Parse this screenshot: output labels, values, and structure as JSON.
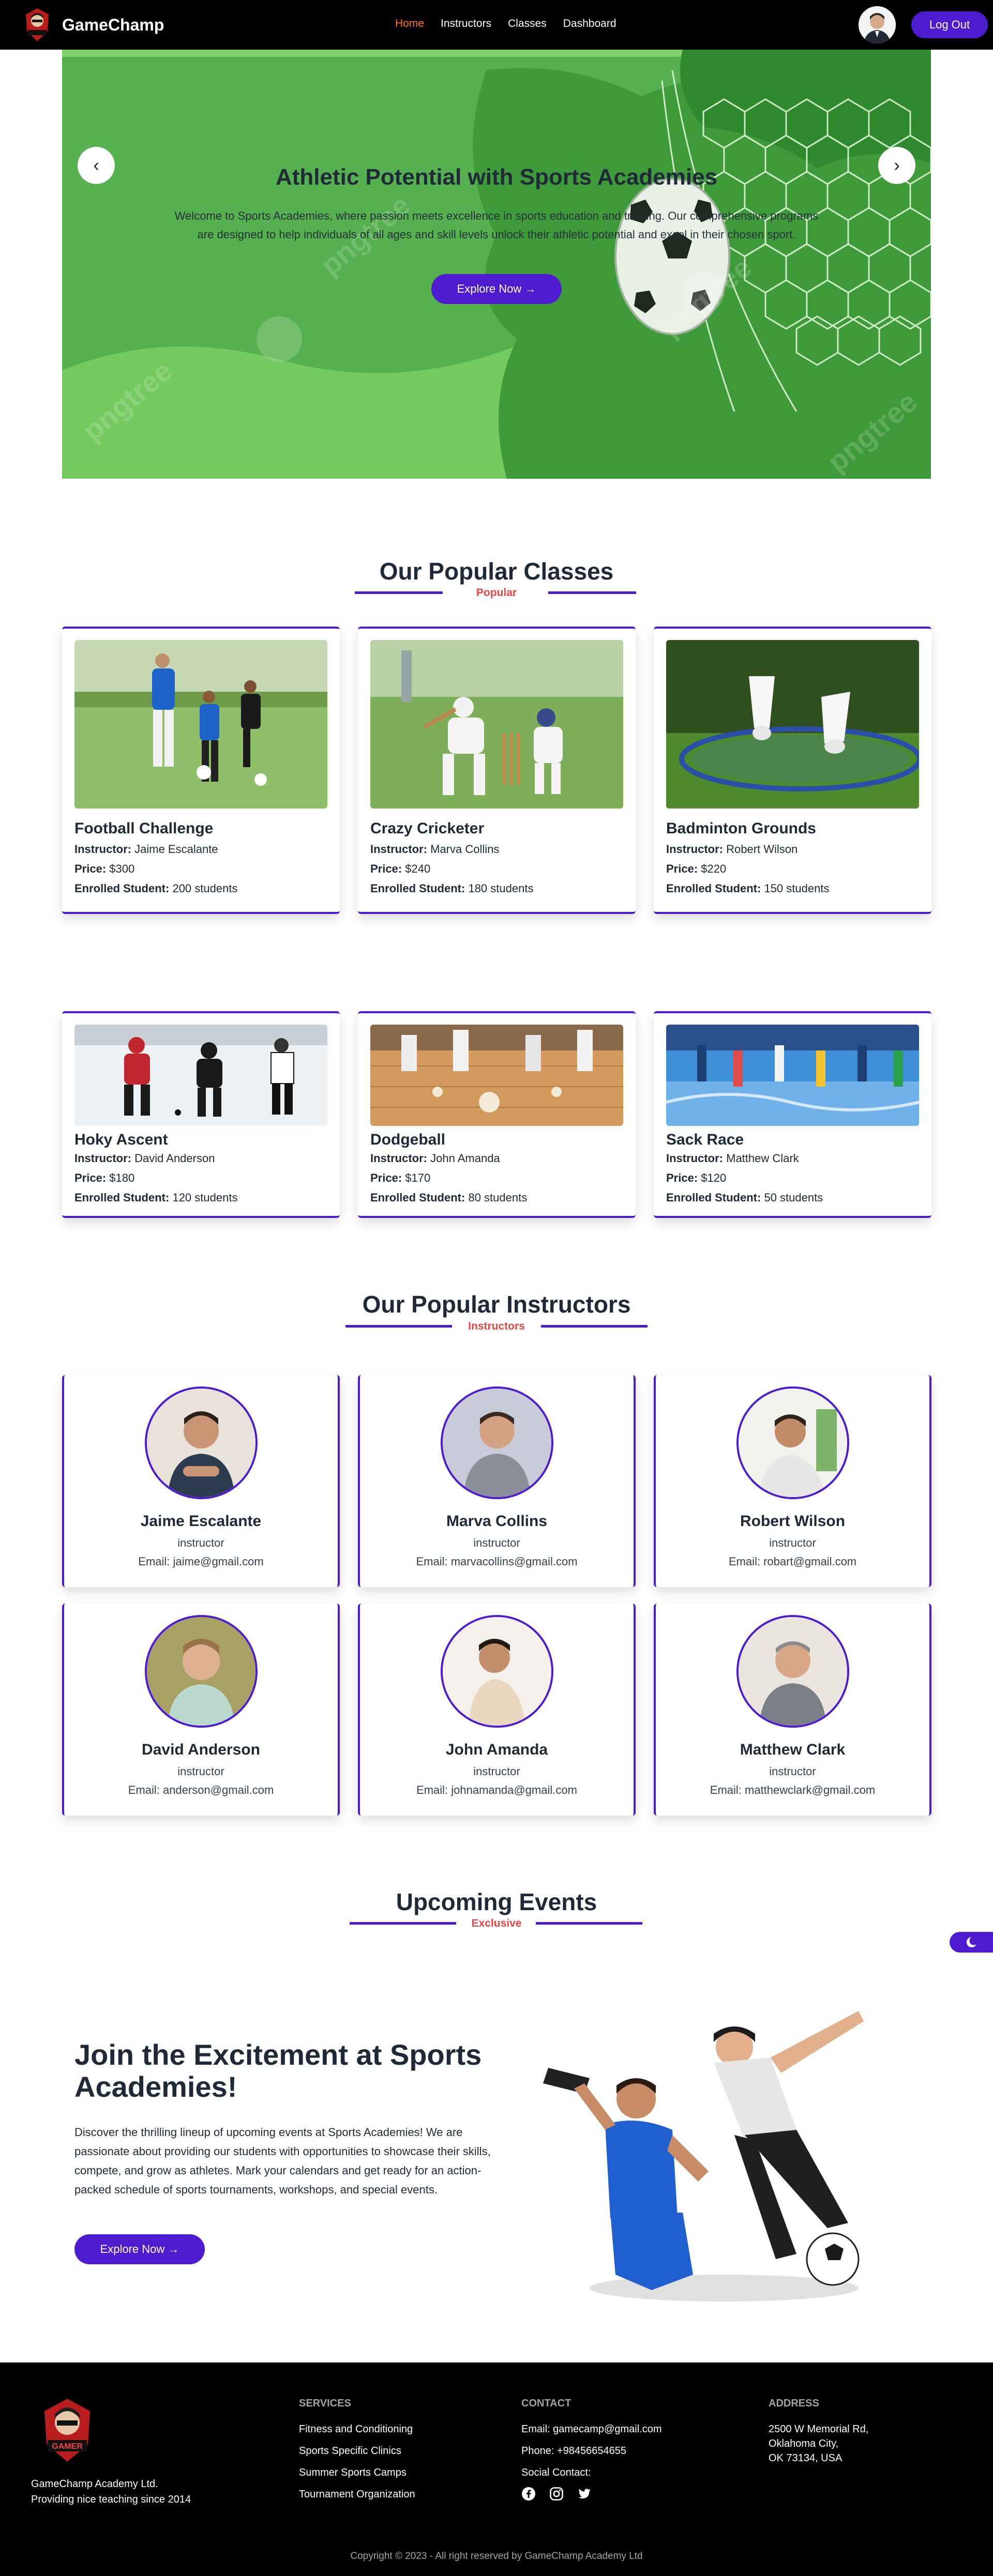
{
  "nav": {
    "brand": "GameChamp",
    "links": [
      "Home",
      "Instructors",
      "Classes",
      "Dashboard"
    ],
    "logout": "Log Out"
  },
  "hero": {
    "title": "Athletic Potential with Sports Academies",
    "text": "Welcome to Sports Academies, where passion meets excellence in sports education and training. Our comprehensive programs are designed to help individuals of all ages and skill levels unlock their athletic potential and excel in their chosen sport.",
    "button": "Explore Now →",
    "prev": "‹",
    "next": "›"
  },
  "classes": {
    "title": "Our Popular Classes",
    "subtitle": "Popular",
    "labels": {
      "instructor": "Instructor:",
      "price": "Price:",
      "enrolled": "Enrolled Student:"
    },
    "items": [
      {
        "name": "Football Challenge",
        "instructor": "Jaime Escalante",
        "price": "$300",
        "enrolled": "200 students"
      },
      {
        "name": "Crazy Cricketer",
        "instructor": "Marva Collins",
        "price": "$240",
        "enrolled": "180 students"
      },
      {
        "name": "Badminton Grounds",
        "instructor": "Robert Wilson",
        "price": "$220",
        "enrolled": "150 students"
      },
      {
        "name": "Hoky Ascent",
        "instructor": "David Anderson",
        "price": "$180",
        "enrolled": "120 students"
      },
      {
        "name": "Dodgeball",
        "instructor": "John Amanda",
        "price": "$170",
        "enrolled": "80 students"
      },
      {
        "name": "Sack Race",
        "instructor": "Matthew Clark",
        "price": "$120",
        "enrolled": "50 students"
      }
    ]
  },
  "instructors": {
    "title": "Our Popular Instructors",
    "subtitle": "Instructors",
    "items": [
      {
        "name": "Jaime Escalante",
        "role": "instructor",
        "email": "Email: jaime@gmail.com"
      },
      {
        "name": "Marva Collins",
        "role": "instructor",
        "email": "Email: marvacollins@gmail.com"
      },
      {
        "name": "Robert Wilson",
        "role": "instructor",
        "email": "Email: robart@gmail.com"
      },
      {
        "name": "David Anderson",
        "role": "instructor",
        "email": "Email: anderson@gmail.com"
      },
      {
        "name": "John Amanda",
        "role": "instructor",
        "email": "Email: johnamanda@gmail.com"
      },
      {
        "name": "Matthew Clark",
        "role": "instructor",
        "email": "Email: matthewclark@gmail.com"
      }
    ]
  },
  "events": {
    "title": "Upcoming Events",
    "subtitle": "Exclusive",
    "heading": "Join the Excitement at Sports Academies!",
    "text": "Discover the thrilling lineup of upcoming events at Sports Academies! We are passionate about providing our students with opportunities to showcase their skills, compete, and grow as athletes. Mark your calendars and get ready for an action-packed schedule of sports tournaments, workshops, and special events.",
    "button": "Explore Now →"
  },
  "footer": {
    "company_line1": "GameChamp Academy Ltd.",
    "company_line2": "Providing nice teaching since 2014",
    "services_title": "SERVICES",
    "services": [
      "Fitness and Conditioning",
      "Sports Specific Clinics",
      "Summer Sports Camps",
      "Tournament Organization"
    ],
    "contact_title": "CONTACT",
    "email": "Email: gamecamp@gmail.com",
    "phone": "Phone: +98456654655",
    "social": "Social Contact:",
    "address_title": "ADDRESS",
    "address": [
      "2500 W Memorial Rd,",
      "Oklahoma City,",
      "OK 73134, USA"
    ],
    "copyright": "Copyright © 2023 - All right reserved by GameChamp Academy Ltd",
    "logo_text": "GAMER"
  },
  "colors": {
    "accent": "#4f1bd1",
    "active_nav": "#f97316",
    "subtitle": "#ef4444",
    "hero_green": "#5cb85c"
  }
}
